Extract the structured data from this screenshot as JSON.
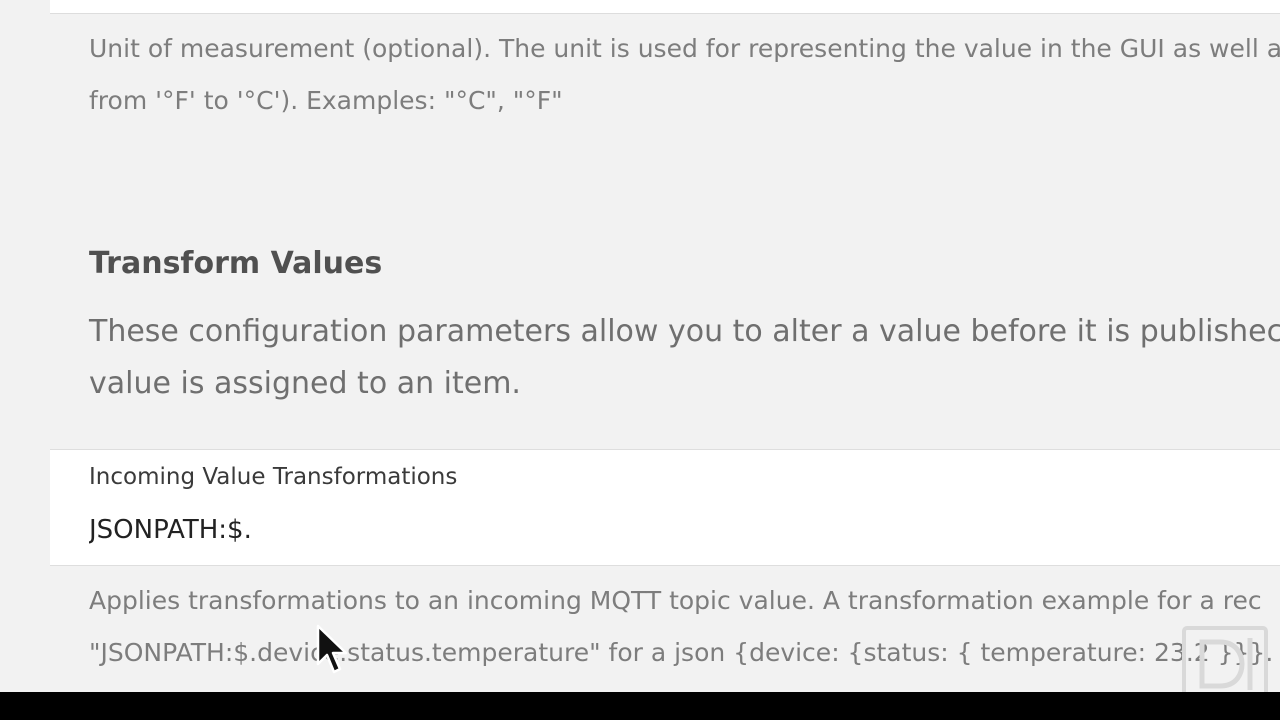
{
  "unit_field": {
    "description_line1": "Unit of measurement (optional). The unit is used for representing the value in the GUI as well a",
    "description_line2": "from '°F' to '°C'). Examples: \"°C\", \"°F\""
  },
  "transform_section": {
    "title": "Transform Values",
    "description_line1": "These configuration parameters allow you to alter a value before it is publishec",
    "description_line2": "value is assigned to an item."
  },
  "incoming_transform": {
    "label": "Incoming Value Transformations",
    "value": "JSONPATH:$.",
    "description_line1": "Applies transformations to an incoming MQTT topic value. A transformation example for a rec",
    "description_line2": "\"JSONPATH:$.device.status.temperature\" for a json {device: {status: { temperature: 23.2 }}}. You"
  },
  "icons": {
    "cursor": "mouse-pointer-icon",
    "watermark": "watermark-logo"
  },
  "colors": {
    "page_background": "#f2f2f2",
    "card_background": "#ffffff",
    "hint_text": "#7d7d7d",
    "title_text": "#505050"
  }
}
